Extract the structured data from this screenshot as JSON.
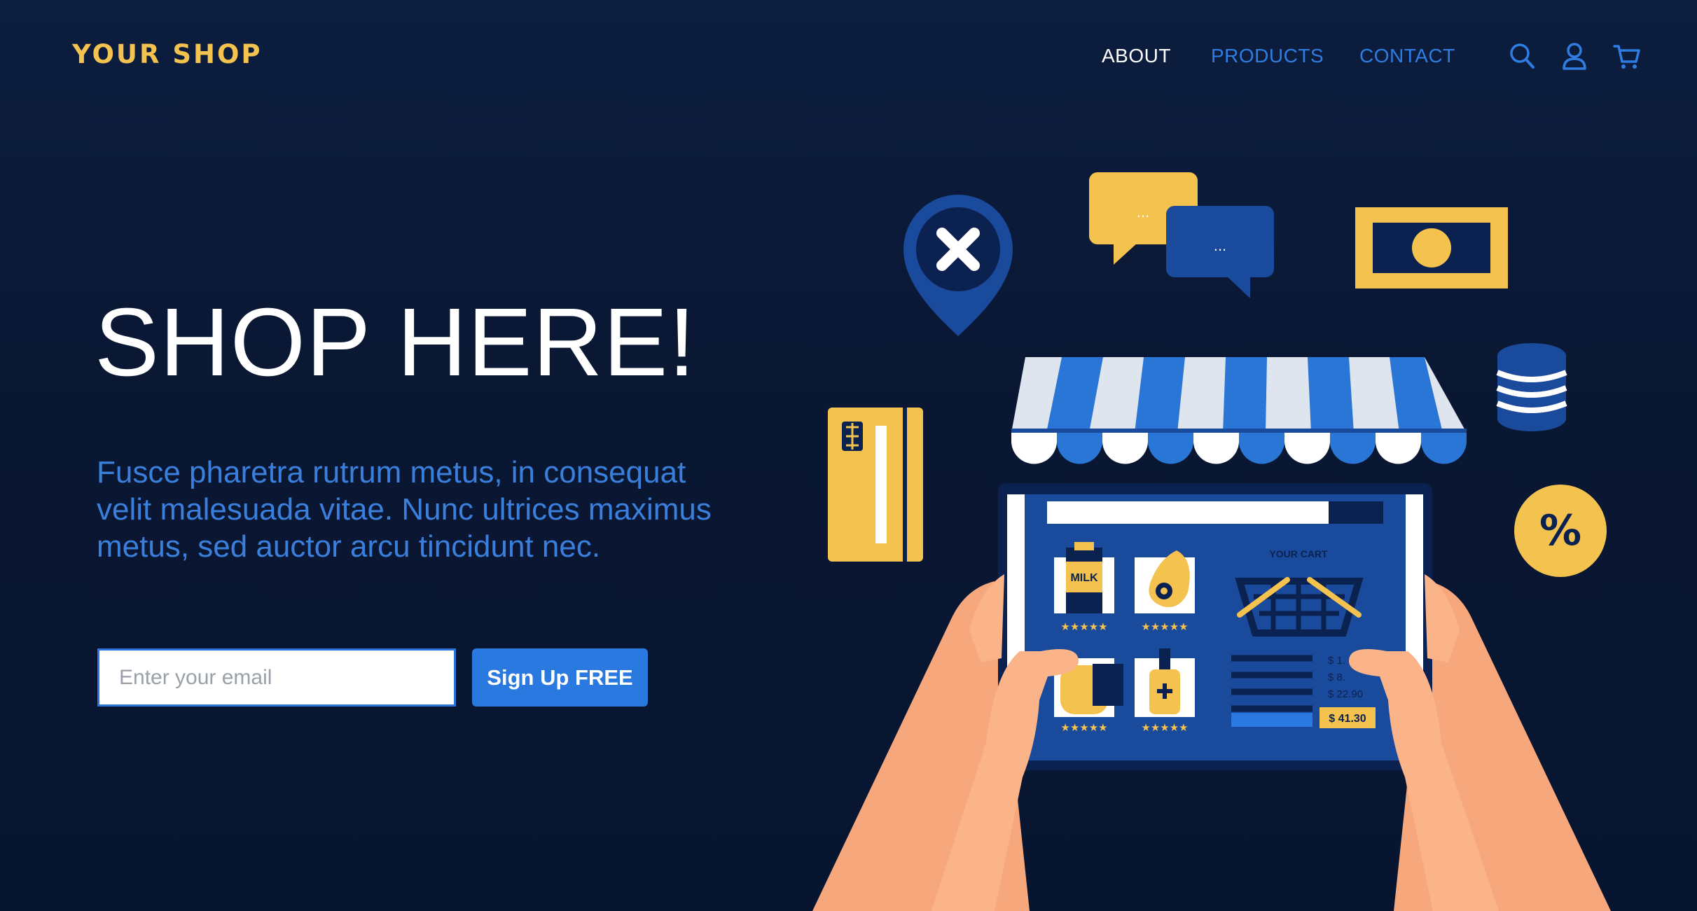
{
  "header": {
    "logo": "YOUR SHOP",
    "nav": [
      {
        "label": "ABOUT",
        "active": true
      },
      {
        "label": "PRODUCTS",
        "active": false
      },
      {
        "label": "CONTACT",
        "active": false
      }
    ],
    "icons": [
      "search-icon",
      "user-icon",
      "cart-icon"
    ]
  },
  "hero": {
    "title": "SHOP HERE!",
    "description": "Fusce pharetra rutrum metus, in consequat velit malesuada vitae. Nunc ultrices maximus metus, sed auctor arcu tincidunt nec.",
    "email_placeholder": "Enter your email",
    "signup_label": "Sign Up FREE"
  },
  "illustration": {
    "cart_title": "YOUR CART",
    "products": [
      {
        "label": "MILK",
        "rating": 5
      },
      {
        "label": "",
        "rating": 5
      },
      {
        "label": "",
        "rating": 5
      },
      {
        "label": "",
        "rating": 5
      }
    ],
    "prices": [
      "$ 1.",
      "$ 8.",
      "$ 22.90"
    ],
    "total": "$ 41.30",
    "percent_badge": "%",
    "chat_dots": "..."
  },
  "colors": {
    "background": "#0a1733",
    "accent_blue": "#2979e0",
    "brand_yellow": "#f4c24e",
    "white": "#ffffff"
  }
}
